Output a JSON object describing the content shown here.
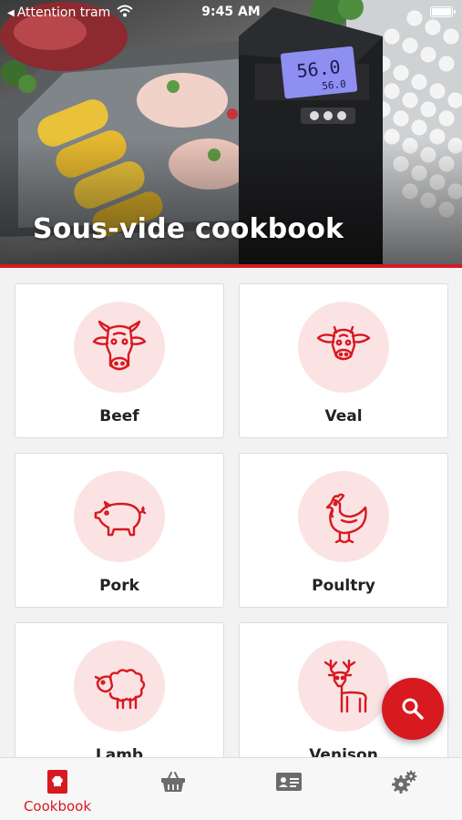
{
  "status_bar": {
    "back_label": "Attention tram",
    "time": "9:45 AM"
  },
  "hero": {
    "title": "Sous-vide cookbook",
    "device_display": {
      "primary": "56.0",
      "secondary": "56.0"
    }
  },
  "categories": [
    {
      "label": "Beef",
      "icon": "cow-icon"
    },
    {
      "label": "Veal",
      "icon": "calf-icon"
    },
    {
      "label": "Pork",
      "icon": "pig-icon"
    },
    {
      "label": "Poultry",
      "icon": "chicken-icon"
    },
    {
      "label": "Lamb",
      "icon": "sheep-icon"
    },
    {
      "label": "Venison",
      "icon": "deer-icon"
    }
  ],
  "fab": {
    "icon": "search-icon"
  },
  "tabbar": {
    "active_index": 0,
    "tabs": [
      {
        "label": "Cookbook",
        "icon": "cookbook-icon"
      },
      {
        "label": "",
        "icon": "basket-icon"
      },
      {
        "label": "",
        "icon": "contact-card-icon"
      },
      {
        "label": "",
        "icon": "settings-gears-icon"
      }
    ]
  },
  "colors": {
    "accent": "#d71920",
    "icon_circle": "#fbe3e4",
    "inactive_icon": "#6b6b6b"
  }
}
